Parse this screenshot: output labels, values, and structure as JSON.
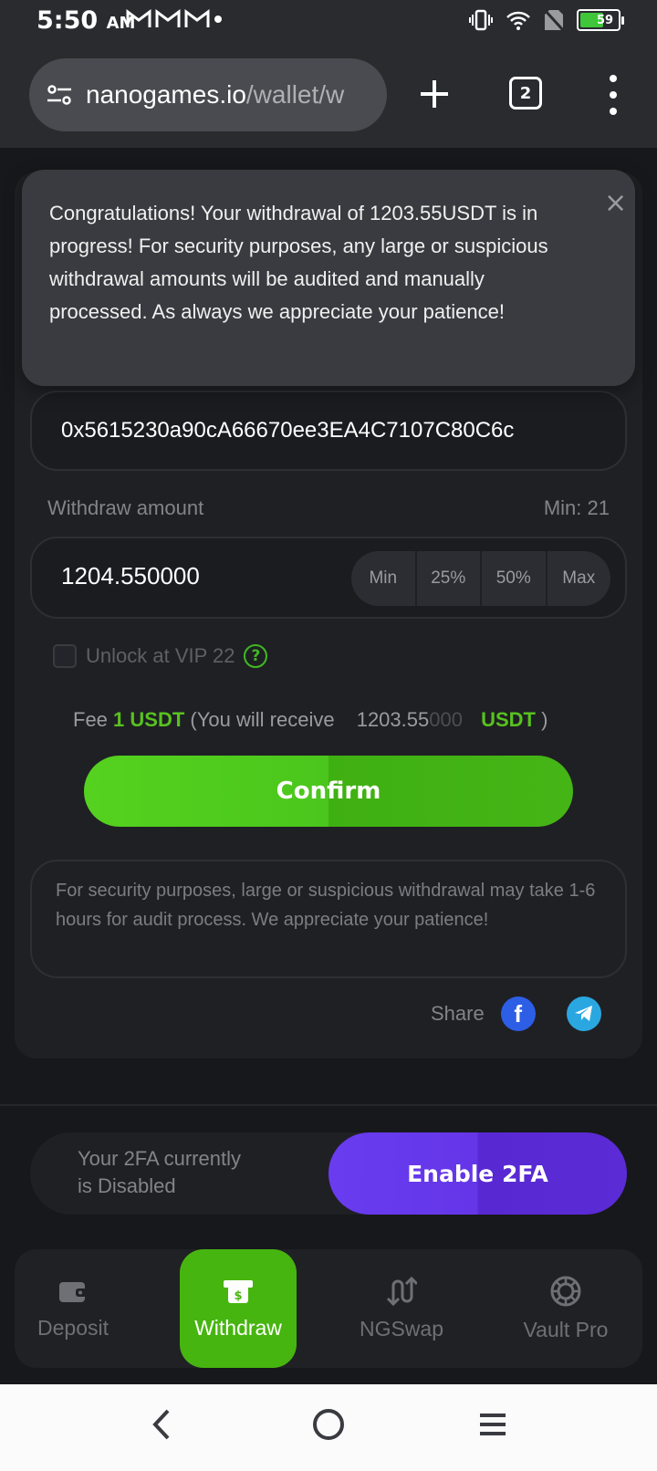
{
  "status_bar": {
    "time": "5:50",
    "ampm": "AM",
    "battery_level": "59",
    "colors": {
      "battery_fill": "#3fc63b"
    }
  },
  "browser": {
    "url_host": "nanogames.io",
    "url_path": "/wallet/w",
    "tab_count": "2"
  },
  "toast": {
    "message": "Congratulations! Your withdrawal of 1203.55USDT is in progress! For security purposes, any large or suspicious withdrawal amounts will be audited and manually processed. As always we appreciate your patience!",
    "close_icon": "×"
  },
  "withdraw": {
    "address": "0x5615230a90cA66670ee3EA4C7107C80C6c",
    "amount_label": "Withdraw amount",
    "min_label": "Min: 21",
    "amount_value": "1204.550000",
    "quick_buttons": [
      "Min",
      "25%",
      "50%",
      "Max"
    ],
    "vip_label": "Unlock at VIP 22",
    "help_icon": "?",
    "fee": {
      "label": "Fee",
      "value": "1 USDT",
      "receive_prefix": "(You will receive",
      "receive_main": "1203.55",
      "receive_dim": "000",
      "unit": "USDT",
      "suffix": ")"
    },
    "confirm_label": "Confirm",
    "notice": "For security purposes, large or suspicious withdrawal may take 1-6 hours for audit process. We appreciate your patience!",
    "share_label": "Share",
    "facebook_glyph": "f"
  },
  "twofa": {
    "line1": "Your 2FA currently",
    "line2": "is Disabled",
    "enable_label": "Enable 2FA"
  },
  "bottom_nav": {
    "items": [
      {
        "label": "Deposit",
        "icon": "wallet-icon",
        "active": false
      },
      {
        "label": "Withdraw",
        "icon": "withdraw-cash-icon",
        "active": true
      },
      {
        "label": "NGSwap",
        "icon": "swap-icon",
        "active": false
      },
      {
        "label": "Vault Pro",
        "icon": "vault-icon",
        "active": false
      }
    ]
  },
  "colors": {
    "accent_green": "#47b510",
    "fee_green": "#58c21e",
    "accent_purple": "#6436e8",
    "facebook_blue": "#2d5ee6",
    "telegram_blue": "#2aa7e1"
  }
}
